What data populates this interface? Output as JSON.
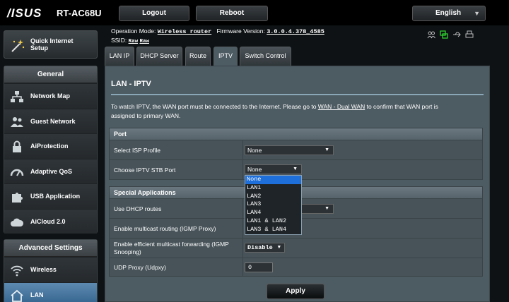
{
  "header": {
    "brand": "/ISUS",
    "model": "RT-AC68U",
    "logout_label": "Logout",
    "reboot_label": "Reboot",
    "language": "English"
  },
  "info": {
    "operation_mode_label": "Operation Mode:",
    "operation_mode_value": "Wireless router",
    "firmware_label": "Firmware Version:",
    "firmware_value": "3.0.0.4.378_4585",
    "ssid_label": "SSID:",
    "ssid_1": "Raw",
    "ssid_2": "Raw"
  },
  "sidebar": {
    "qis_label_1": "Quick Internet",
    "qis_label_2": "Setup",
    "general_title": "General",
    "general_items": [
      {
        "label": "Network Map",
        "icon": "network-map-icon"
      },
      {
        "label": "Guest Network",
        "icon": "guest-network-icon"
      },
      {
        "label": "AiProtection",
        "icon": "lock-icon"
      },
      {
        "label": "Adaptive QoS",
        "icon": "gauge-icon"
      },
      {
        "label": "USB Application",
        "icon": "puzzle-icon"
      },
      {
        "label": "AiCloud 2.0",
        "icon": "cloud-icon"
      }
    ],
    "advanced_title": "Advanced Settings",
    "advanced_items": [
      {
        "label": "Wireless",
        "icon": "wifi-icon"
      },
      {
        "label": "LAN",
        "icon": "home-icon"
      }
    ]
  },
  "tabs": [
    "LAN IP",
    "DHCP Server",
    "Route",
    "IPTV",
    "Switch Control"
  ],
  "active_tab": "IPTV",
  "main": {
    "title": "LAN - IPTV",
    "desc_1": "To watch IPTV, the WAN port must be connected to the Internet. Please go to ",
    "desc_link": "WAN - Dual WAN",
    "desc_2": " to confirm that WAN port is",
    "desc_3": "assigned to primary WAN.",
    "port_section": "Port",
    "isp_profile_label": "Select ISP Profile",
    "isp_profile_value": "None",
    "stb_port_label": "Choose IPTV STB Port",
    "stb_port_value": "None",
    "special_section": "Special Applications",
    "dhcp_routes_label": "Use DHCP routes",
    "multicast_label": "Enable multicast routing (IGMP Proxy)",
    "efficient_label_1": "Enable efficient multicast forwarding (IGMP",
    "efficient_label_2": "Snooping)",
    "efficient_value": "Disable",
    "udpxy_label": "UDP Proxy (Udpxy)",
    "udpxy_value": "0",
    "apply_label": "Apply"
  },
  "dropdown_options": [
    "None",
    "LAN1",
    "LAN2",
    "LAN3",
    "LAN4",
    "LAN1 & LAN2",
    "LAN3 & LAN4"
  ],
  "colors": {
    "accent": "#1e6fd9",
    "panel": "#4d5b62",
    "status_green": "#2fd12f"
  }
}
